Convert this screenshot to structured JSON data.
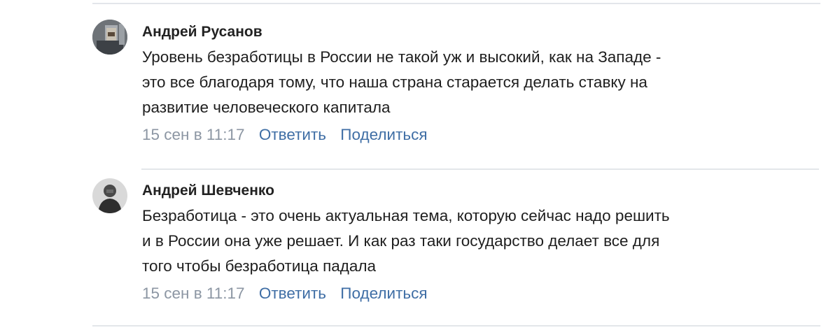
{
  "comments": [
    {
      "author": "Андрей Русанов",
      "avatar_icon": "user-photo-avatar",
      "text_lines": [
        "Уровень безработицы в России не такой уж и высокий, как на Западе -",
        "это все благодаря тому, что наша страна старается делать ставку на",
        "развитие человеческого капитала"
      ],
      "date": "15 сен в 11:17",
      "reply_label": "Ответить",
      "share_label": "Поделиться"
    },
    {
      "author": "Андрей Шевченко",
      "avatar_icon": "user-photo-avatar",
      "text_lines": [
        "Безработица - это очень актуальная тема, которую сейчас надо решить",
        "и в России она уже решает. И как раз таки государство делает все для",
        "того чтобы безработица падала"
      ],
      "date": "15 сен в 11:17",
      "reply_label": "Ответить",
      "share_label": "Поделиться"
    }
  ],
  "colors": {
    "author": "#222222",
    "text": "#1e1e1e",
    "date": "#8c96a3",
    "action_link": "#3f6ea5",
    "divider": "#e3e6ea"
  }
}
